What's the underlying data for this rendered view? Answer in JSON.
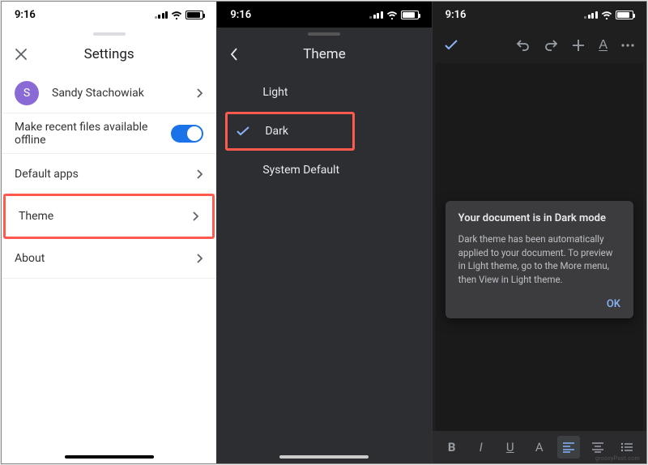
{
  "status": {
    "time": "9:16"
  },
  "screen1": {
    "title": "Settings",
    "account": {
      "initial": "S",
      "name": "Sandy Stachowiak"
    },
    "rows": {
      "offline": "Make recent files available offline",
      "default_apps": "Default apps",
      "theme": "Theme",
      "about": "About"
    }
  },
  "screen2": {
    "title": "Theme",
    "options": {
      "light": "Light",
      "dark": "Dark",
      "system": "System Default"
    }
  },
  "screen3": {
    "dialog": {
      "title": "Your document is in Dark mode",
      "body": "Dark theme has been automatically applied to your document. To preview in Light theme, go to the More menu, then View in Light theme.",
      "ok": "OK"
    },
    "bottom": {
      "bold": "B",
      "italic": "I",
      "underline": "U",
      "textA": "A"
    }
  }
}
